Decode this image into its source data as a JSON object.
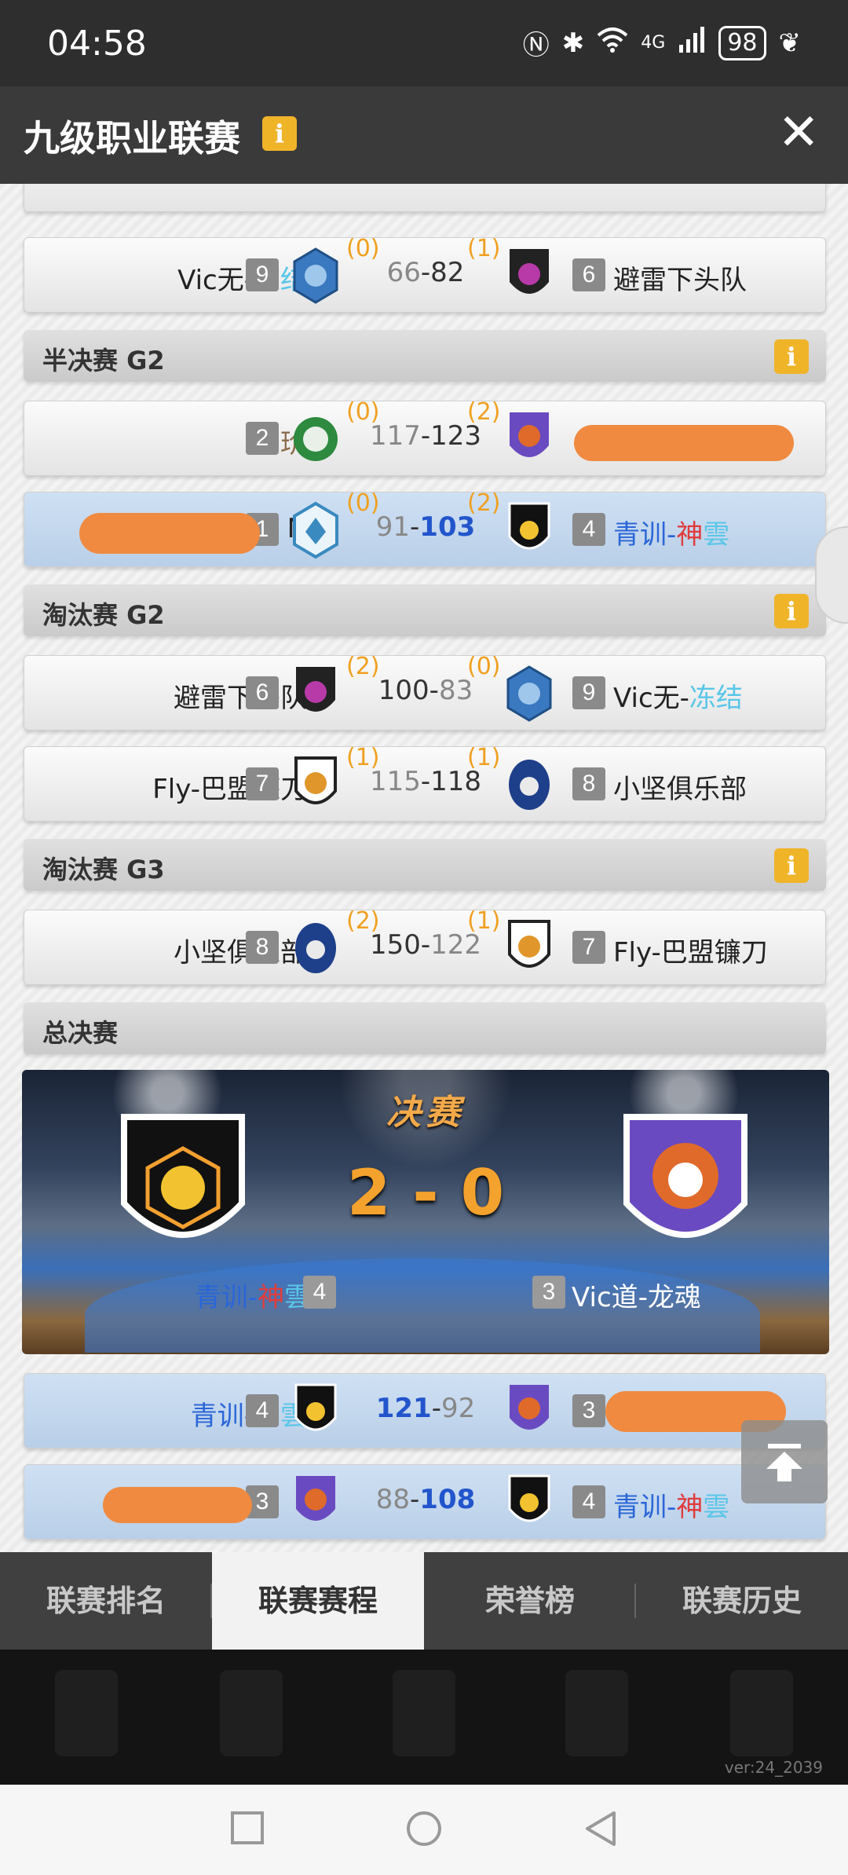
{
  "status": {
    "time": "04:58",
    "battery": "98",
    "network": "4G"
  },
  "header": {
    "title": "九级职业联赛",
    "info": "i",
    "close": "✕"
  },
  "matches_top": [
    {
      "left": {
        "name_a": "Vic无-",
        "name_b": "冻结",
        "rank": "9",
        "wins": "(0)"
      },
      "score_left": "66",
      "score_right": "82",
      "right": {
        "name": "避雷下头队",
        "rank": "6",
        "wins": "(1)"
      }
    }
  ],
  "sections": [
    {
      "title": "半决赛 G2",
      "info": "i"
    },
    {
      "title": "淘汰赛 G2",
      "info": "i"
    },
    {
      "title": "淘汰赛 G3",
      "info": "i"
    },
    {
      "title": "总决赛"
    }
  ],
  "semis": [
    {
      "left_name": "玠",
      "left_rank": "2",
      "left_wins": "(0)",
      "score_left": "117",
      "score_right": "123",
      "right_wins": "(2)"
    },
    {
      "left_name": "N",
      "left_rank": "1",
      "left_wins": "(0)",
      "score_left": "91",
      "score_right": "103",
      "right_wins": "(2)",
      "right_rank": "4",
      "right_a": "青训-",
      "right_b": "神",
      "right_c": "雲"
    }
  ],
  "knockout_g2": [
    {
      "left_name": "避雷下头队",
      "left_rank": "6",
      "left_wins": "(2)",
      "score_left": "100",
      "score_right": "83",
      "right_wins": "(0)",
      "right_rank": "9",
      "right_a": "Vic无-",
      "right_b": "冻结"
    },
    {
      "left_name": "Fly-巴盟镰刀",
      "left_rank": "7",
      "left_wins": "(1)",
      "score_left": "115",
      "score_right": "118",
      "right_wins": "(1)",
      "right_rank": "8",
      "right_name": "小坚俱乐部"
    }
  ],
  "knockout_g3": [
    {
      "left_name": "小坚俱乐部",
      "left_rank": "8",
      "left_wins": "(2)",
      "score_left": "150",
      "score_right": "122",
      "right_wins": "(1)",
      "right_rank": "7",
      "right_name": "Fly-巴盟镰刀"
    }
  ],
  "finals": {
    "title": "决赛",
    "score": "2 - 0",
    "left_a": "青训-",
    "left_b": "神",
    "left_c": "雲",
    "left_rank": "4",
    "right_rank": "3",
    "right_name": "Vic道-龙魂"
  },
  "finals_games": [
    {
      "left_a": "青训-",
      "left_b": "神",
      "left_c": "雲",
      "left_rank": "4",
      "score_left": "121",
      "score_right": "92",
      "right_rank": "3"
    },
    {
      "left_rank": "3",
      "score_left": "88",
      "score_right": "108",
      "right_rank": "4",
      "right_a": "青训-",
      "right_b": "神",
      "right_c": "雲"
    }
  ],
  "tabs": [
    "联赛排名",
    "联赛赛程",
    "荣誉榜",
    "联赛历史"
  ],
  "active_tab": 1,
  "version": "ver:24_2039",
  "colors": {
    "accent_orange": "#f0a020",
    "winner_blue": "#2255cc",
    "cyan": "#59c6e8",
    "red": "#e03c3c",
    "info_yellow": "#f0b429"
  }
}
